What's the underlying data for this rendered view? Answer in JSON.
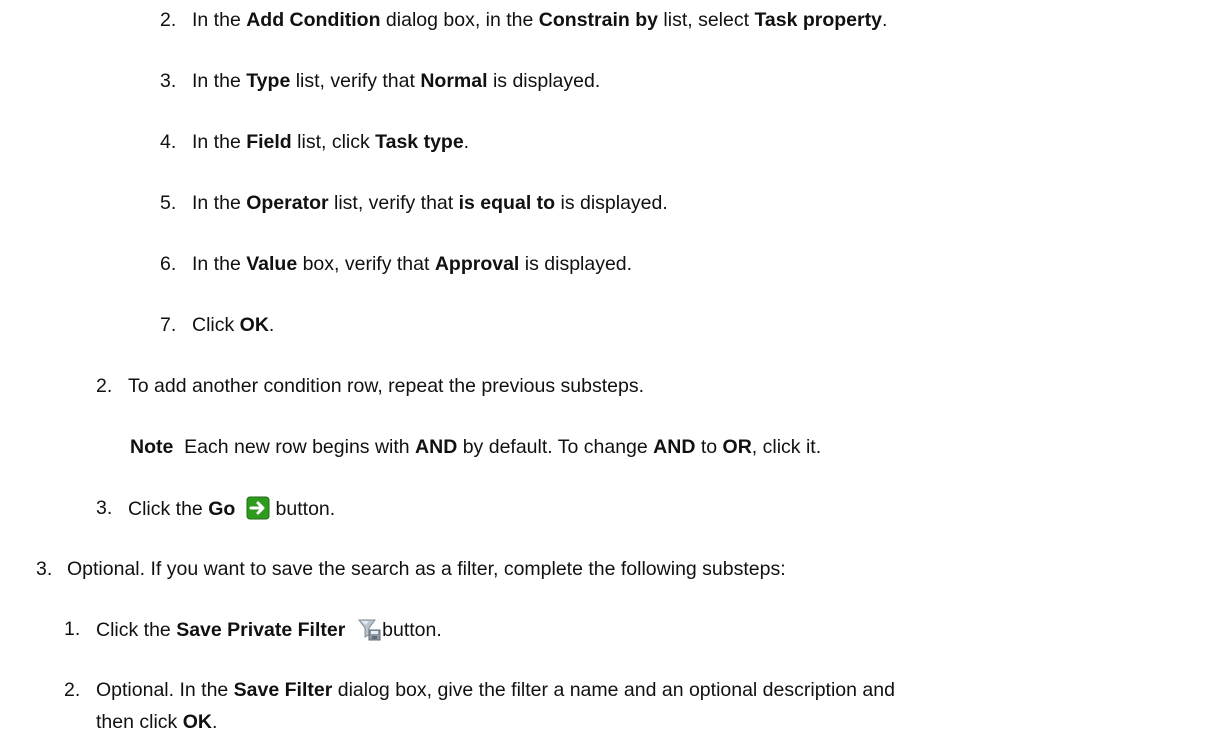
{
  "steps": {
    "s2": {
      "num": "2.",
      "t1": "In the ",
      "b1": "Add Condition",
      "t2": " dialog box, in the ",
      "b2": "Constrain by",
      "t3": " list, select ",
      "b3": "Task property",
      "t4": "."
    },
    "s3": {
      "num": "3.",
      "t1": "In the ",
      "b1": "Type",
      "t2": " list, verify that ",
      "b2": "Normal",
      "t3": " is displayed."
    },
    "s4": {
      "num": "4.",
      "t1": "In the ",
      "b1": "Field",
      "t2": " list, click ",
      "b2": "Task type",
      "t3": "."
    },
    "s5": {
      "num": "5.",
      "t1": "In the ",
      "b1": "Operator",
      "t2": " list, verify that ",
      "b2": "is equal to",
      "t3": " is displayed."
    },
    "s6": {
      "num": "6.",
      "t1": "In the ",
      "b1": "Value",
      "t2": " box, verify that ",
      "b2": "Approval",
      "t3": " is displayed."
    },
    "s7": {
      "num": "7.",
      "t1": "Click ",
      "b1": "OK",
      "t2": "."
    },
    "r2": {
      "num": "2.",
      "t1": "To add another condition row, repeat the previous substeps."
    },
    "note": {
      "b1": "Note",
      "t1": "  Each new row begins with ",
      "b2": "AND",
      "t2": " by default. To change ",
      "b3": "AND",
      "t3": " to ",
      "b4": "OR",
      "t4": ", click it."
    },
    "r3": {
      "num": "3.",
      "t1": "Click the ",
      "b1": "Go",
      "t2": " button."
    },
    "opt3": {
      "num": "3.",
      "t1": "Optional. If you want to save the search as a filter, complete the following substeps:"
    },
    "f1": {
      "num": "1.",
      "t1": "Click the ",
      "b1": "Save Private Filter",
      "t2": "button."
    },
    "f2": {
      "num": "2.",
      "t1": "Optional. In the ",
      "b1": "Save Filter",
      "t2": " dialog box, give the filter a name and an optional description and",
      "t3": "then click ",
      "b2": "OK",
      "t4": "."
    }
  },
  "icons": {
    "go": "go-arrow-icon",
    "filter": "save-private-filter-icon",
    "accent": "#2e9a1e"
  }
}
